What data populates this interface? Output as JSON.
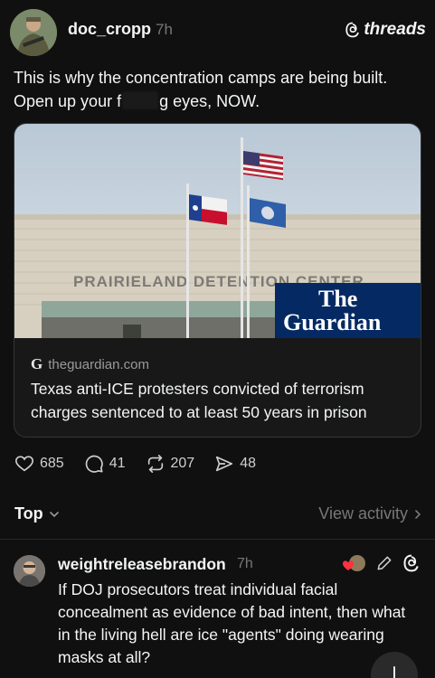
{
  "post": {
    "username": "doc_cropp",
    "time": "7h",
    "brand": "threads",
    "text_part1": "This is why the concentration camps are being built. Open up your f",
    "text_part2": "g eyes, NOW."
  },
  "link_card": {
    "image_sign": "PRAIRIELAND DETENTION CENTER",
    "publisher_logo_line1": "The",
    "publisher_logo_line2": "Guardian",
    "source_icon": "G",
    "source": "theguardian.com",
    "title": "Texas anti-ICE protesters convicted of terrorism charges sentenced to at least 50 years in prison"
  },
  "actions": {
    "likes": "685",
    "comments": "41",
    "reposts": "207",
    "shares": "48"
  },
  "sort": {
    "label": "Top",
    "view_activity": "View activity"
  },
  "reply": {
    "username": "weightreleasebrandon",
    "time": "7h",
    "text": "If DOJ prosecutors treat individual facial concealment as evidence of bad intent, then what in the living hell are ice \"agents\" doing wearing masks at all?"
  },
  "icons": [
    "heart-icon",
    "comment-icon",
    "repost-icon",
    "share-icon",
    "chevron-down-icon",
    "chevron-right-icon",
    "edit-icon",
    "threads-logo-icon",
    "compose-icon"
  ],
  "colors": {
    "background": "#101010",
    "text": "#f3f5f7",
    "muted": "#777777",
    "guardian_blue": "#052962"
  }
}
